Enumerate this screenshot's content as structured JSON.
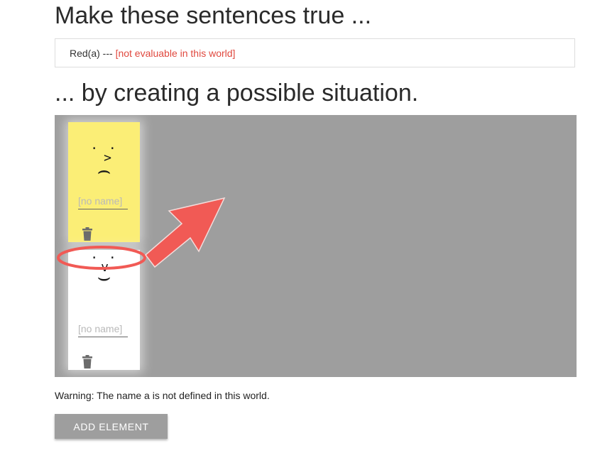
{
  "headings": {
    "top": "Make these sentences true ...",
    "middle": "... by creating a possible situation."
  },
  "sentences": [
    {
      "formula": "Red(a)",
      "separator": " --- ",
      "status": "[not evaluable in this world]"
    }
  ],
  "elements": [
    {
      "color": "#fbee76",
      "face": {
        "eyes": ". .",
        "nose": ">",
        "mouth": "⌢"
      },
      "name_value": "",
      "name_placeholder": "[no name]",
      "delete_icon": "trash-icon"
    },
    {
      "color": "#ffffff",
      "face": {
        "eyes": ". .",
        "nose": "v",
        "mouth": "⌣"
      },
      "name_value": "",
      "name_placeholder": "[no name]",
      "delete_icon": "trash-icon"
    }
  ],
  "warning": "Warning: The name a is not defined in this world.",
  "buttons": {
    "add_element": "ADD ELEMENT"
  },
  "colors": {
    "canvas_background": "#9e9e9e",
    "error_text": "#e0483e",
    "annotation": "#f15a55",
    "button_background": "#9e9e9e"
  }
}
